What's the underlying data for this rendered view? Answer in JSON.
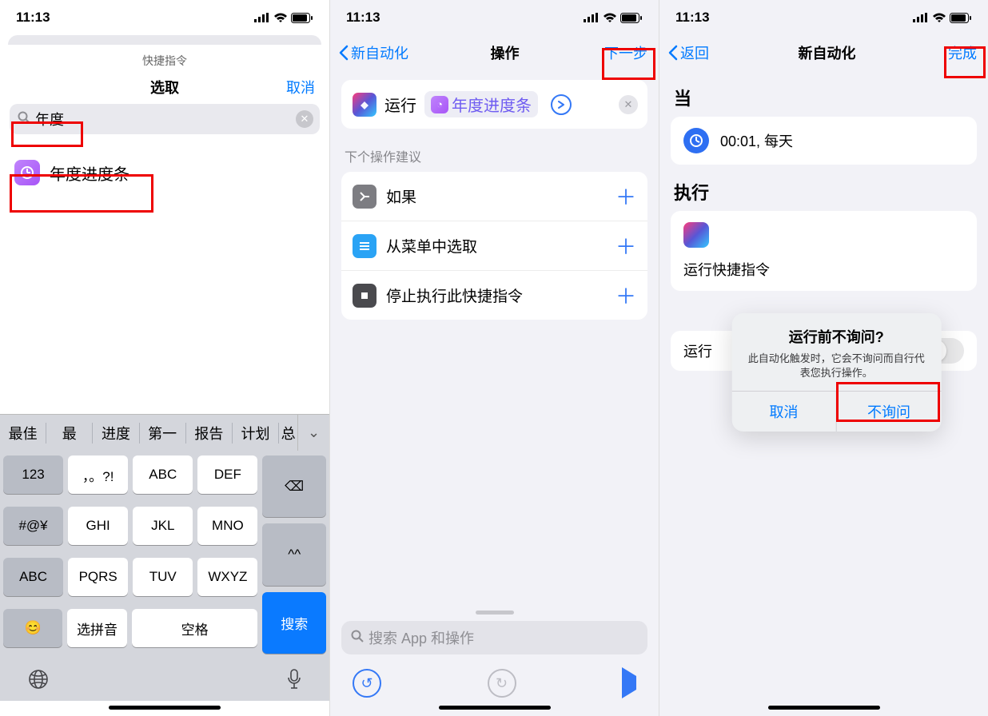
{
  "status": {
    "time": "11:13"
  },
  "phone1": {
    "card_title": "快捷指令",
    "select_title": "选取",
    "cancel": "取消",
    "search_value": "年度",
    "result_label": "年度进度条"
  },
  "keyboard": {
    "candidates": [
      "最佳",
      "最",
      "进度",
      "第一",
      "报告",
      "计划",
      "总"
    ],
    "row1": [
      "123",
      "，。?!",
      "ABC",
      "DEF"
    ],
    "row2": [
      "#@¥",
      "GHI",
      "JKL",
      "MNO",
      "^^"
    ],
    "row3": [
      "ABC",
      "PQRS",
      "TUV",
      "WXYZ"
    ],
    "row4": [
      "😊",
      "选拼音",
      "空格"
    ],
    "delete": "⌫",
    "search": "搜索"
  },
  "phone2": {
    "back": "新自动化",
    "title": "操作",
    "next": "下一步",
    "run_word": "运行",
    "shortcut_name": "年度进度条",
    "section": "下个操作建议",
    "suggestions": [
      "如果",
      "从菜单中选取",
      "停止执行此快捷指令"
    ],
    "search_placeholder": "搜索 App 和操作"
  },
  "phone3": {
    "back": "返回",
    "title": "新自动化",
    "done": "完成",
    "when_label": "当",
    "cond_text": "00:01,   每天",
    "exec_label": "执行",
    "exec_text": "运行快捷指令",
    "ask_label": "运行",
    "alert_title": "运行前不询问?",
    "alert_msg": "此自动化触发时，它会不询问而自行代表您执行操作。",
    "alert_cancel": "取消",
    "alert_confirm": "不询问"
  }
}
